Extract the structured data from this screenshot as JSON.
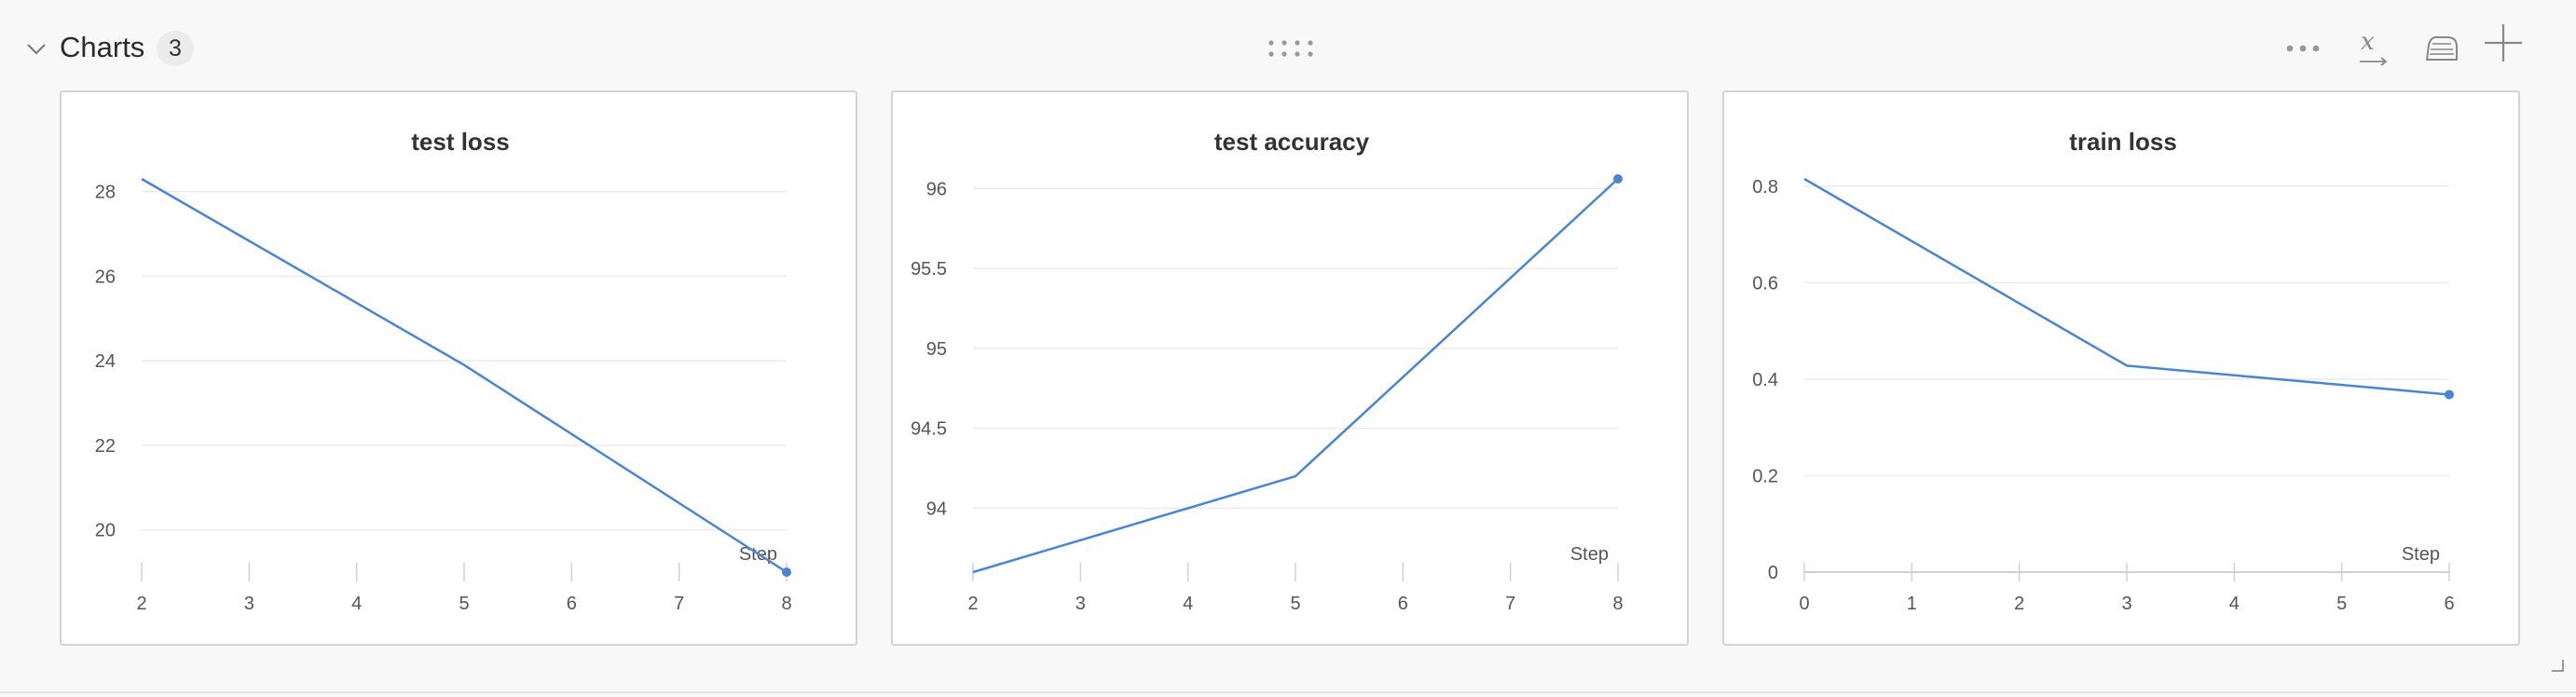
{
  "section": {
    "title": "Charts",
    "count": "3"
  },
  "header_icons": [
    "chevron-down-icon",
    "drag-handle-icon",
    "more-options-icon",
    "x-axis-settings-icon",
    "smoothing-iron-icon",
    "add-panel-icon"
  ],
  "colors": {
    "line": "#4a86d0",
    "grid": "#ebebeb",
    "axis": "#d0d0d0",
    "background": "#f8f8f8",
    "panel_border": "#d4d4d4"
  },
  "chart_data": [
    {
      "type": "line",
      "title": "test loss",
      "xlabel": "Step",
      "ylabel": "",
      "x": [
        2,
        5,
        8
      ],
      "y": [
        28.3,
        23.9,
        19.0
      ],
      "xlim": [
        2,
        8
      ],
      "ylim": [
        19.0,
        28.3
      ],
      "xticks": [
        2,
        3,
        4,
        5,
        6,
        7,
        8
      ],
      "yticks": [
        20,
        22,
        24,
        26,
        28
      ],
      "ytick_labels": [
        "20",
        "22",
        "24",
        "26",
        "28"
      ],
      "grid": true
    },
    {
      "type": "line",
      "title": "test accuracy",
      "xlabel": "Step",
      "ylabel": "",
      "x": [
        2,
        5,
        8
      ],
      "y": [
        93.6,
        94.2,
        96.06
      ],
      "xlim": [
        2,
        8
      ],
      "ylim": [
        93.6,
        96.06
      ],
      "xticks": [
        2,
        3,
        4,
        5,
        6,
        7,
        8
      ],
      "yticks": [
        94,
        94.5,
        95,
        95.5,
        96
      ],
      "ytick_labels": [
        "94",
        "94.5",
        "95",
        "95.5",
        "96"
      ],
      "grid": true
    },
    {
      "type": "line",
      "title": "train loss",
      "xlabel": "Step",
      "ylabel": "",
      "x": [
        0,
        3,
        6
      ],
      "y": [
        0.815,
        0.428,
        0.368
      ],
      "xlim": [
        0,
        6
      ],
      "ylim": [
        0,
        0.815
      ],
      "xticks": [
        0,
        1,
        2,
        3,
        4,
        5,
        6
      ],
      "yticks": [
        0,
        0.2,
        0.4,
        0.6,
        0.8
      ],
      "ytick_labels": [
        "0",
        "0.2",
        "0.4",
        "0.6",
        "0.8"
      ],
      "grid": true
    }
  ]
}
